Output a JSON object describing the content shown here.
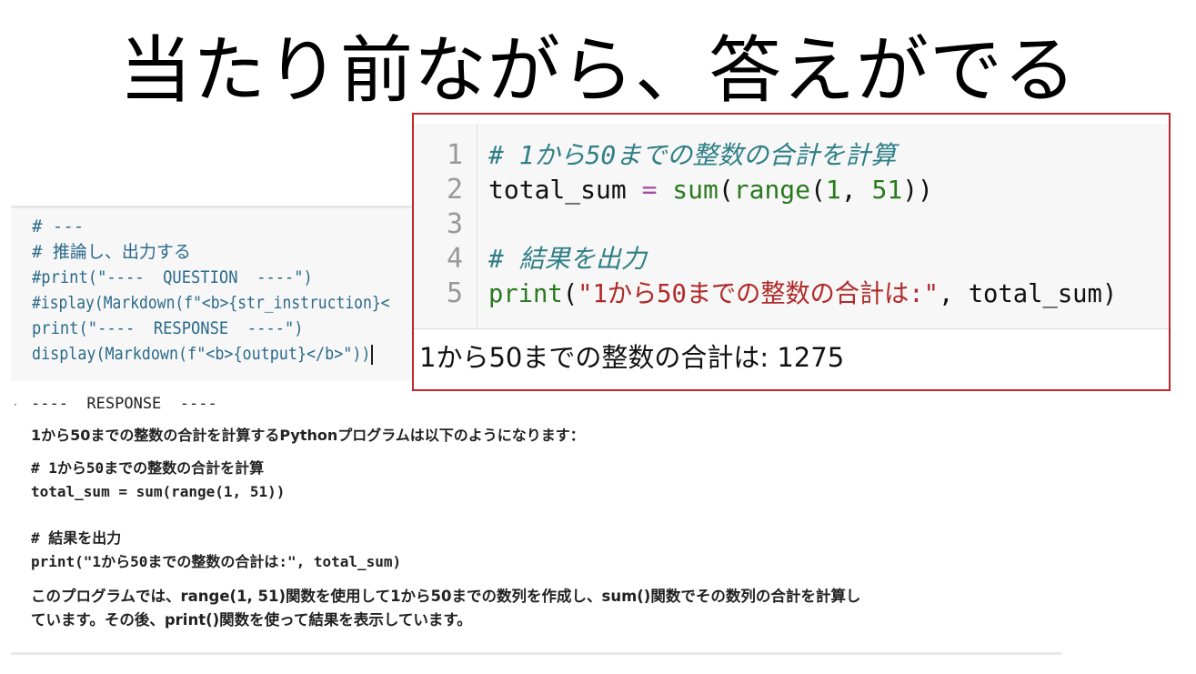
{
  "slide": {
    "title": "当たり前ながら、答えがでる"
  },
  "notebook_cell": {
    "lines": [
      "# ---",
      "# 推論し、出力する",
      "#print(\"----  QUESTION  ----\")",
      "#isplay(Markdown(f\"<b>{str_instruction}<",
      "print(\"----  RESPONSE  ----\")",
      "display(Markdown(f\"<b>{output}</b>\"))"
    ]
  },
  "output": {
    "separator": "----  RESPONSE  ----",
    "intro": "1から50までの整数の合計を計算するPythonプログラムは以下のようになります：",
    "code_lines": [
      "# 1から50までの整数の合計を計算",
      "total_sum = sum(range(1, 51))",
      "",
      "# 結果を出力",
      "print(\"1から50までの整数の合計は:\", total_sum)"
    ],
    "explanation_line1": "このプログラムでは、range(1, 51)関数を使用して1から50までの数列を作成し、sum()関数でその数列の合計を計算し",
    "explanation_line2": "ています。その後、print()関数を使って結果を表示しています。"
  },
  "code_panel": {
    "line_numbers": [
      "1",
      "2",
      "3",
      "4",
      "5"
    ],
    "line1_comment": "# 1から50までの整数の合計を計算",
    "line2": {
      "var": "total_sum",
      "op": "=",
      "func": "sum",
      "inner_func": "range",
      "arg1": "1",
      "arg2": "51"
    },
    "line4_comment": "# 結果を出力",
    "line5": {
      "func": "print",
      "string": "\"1から50までの整数の合計は:\"",
      "var": "total_sum"
    },
    "result": "1から50までの整数の合計は: 1275"
  },
  "colors": {
    "panel_border": "#c0262c",
    "comment": "#2f7f86",
    "keyword_func": "#2b7a1f",
    "string": "#b02a2a",
    "operator": "#a34ca0"
  }
}
